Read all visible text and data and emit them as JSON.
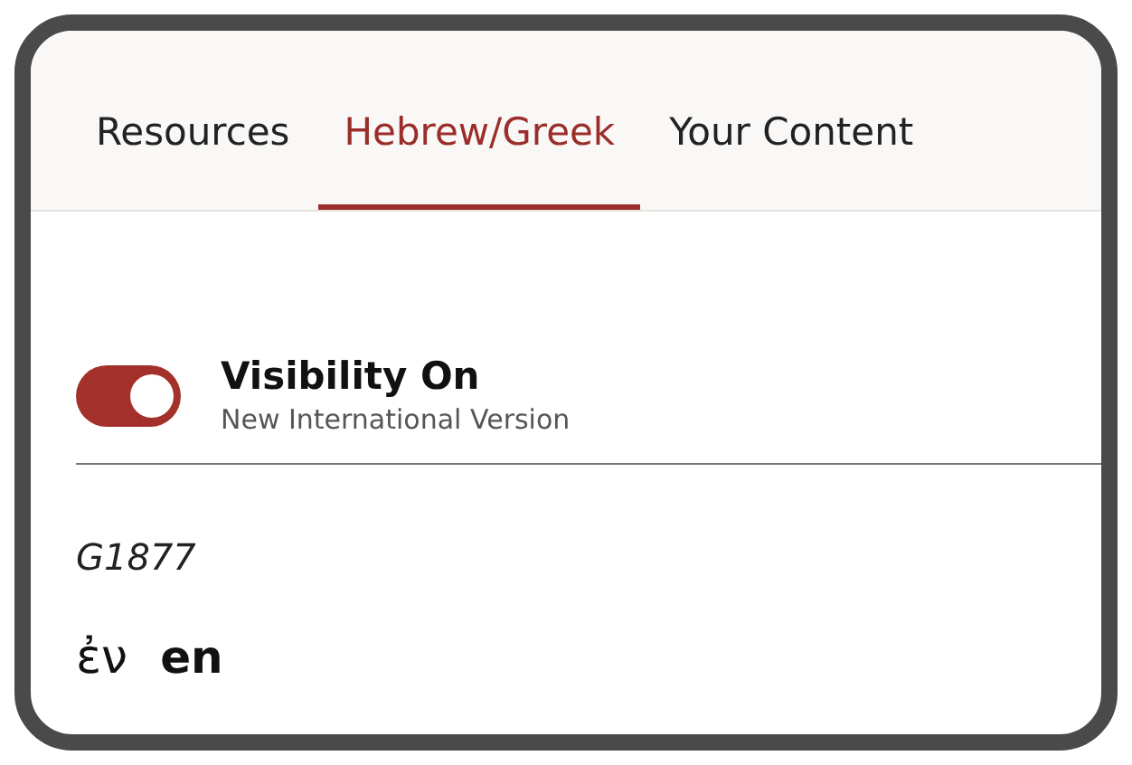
{
  "tabs": [
    {
      "label": "Resources",
      "selected": false
    },
    {
      "label": "Hebrew/Greek",
      "selected": true
    },
    {
      "label": "Your Content",
      "selected": false
    }
  ],
  "visibility": {
    "on": true,
    "label": "Visibility On",
    "subtitle": "New International Version"
  },
  "entry": {
    "number": "G1877",
    "lemma": "ἐν",
    "transliteration": "en"
  }
}
